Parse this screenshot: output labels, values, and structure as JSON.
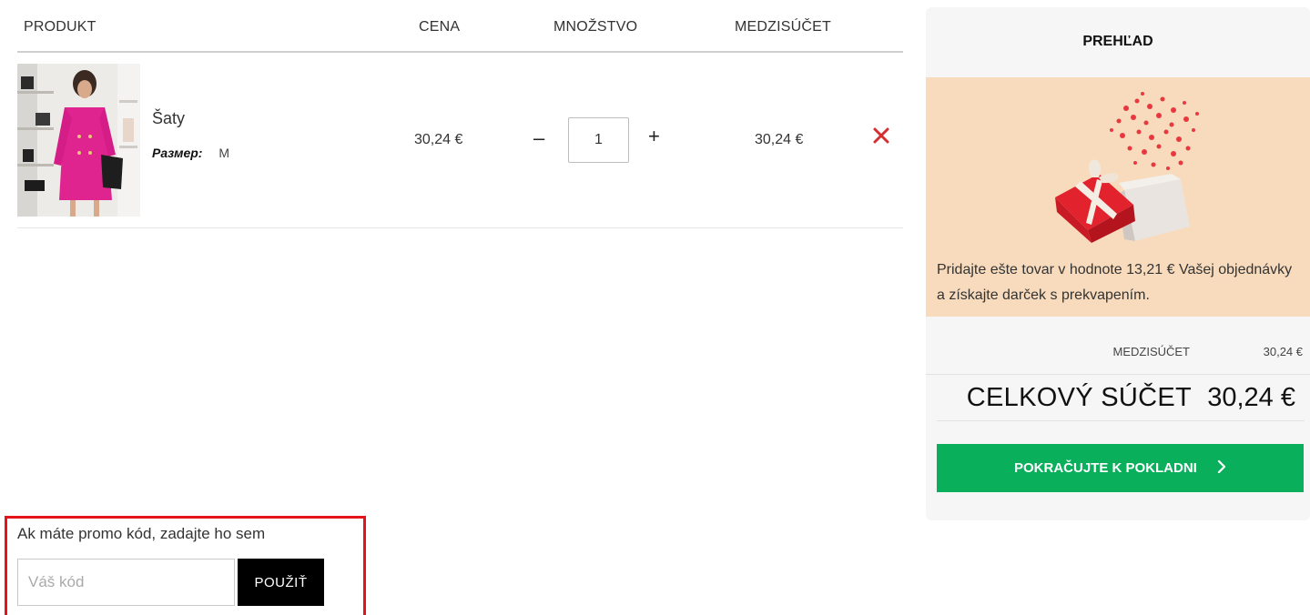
{
  "cart": {
    "headers": {
      "product": "PRODUKT",
      "price": "CENA",
      "quantity": "MNOŽSTVO",
      "subtotal": "MEDZISÚČET"
    },
    "items": [
      {
        "name": "Šaty",
        "size_label": "Размер:",
        "size_value": "M",
        "price": "30,24 €",
        "quantity": "1",
        "subtotal": "30,24 €",
        "image_icon": "product-photo-pink-dress"
      }
    ],
    "qty_minus": "–",
    "qty_plus": "+",
    "remove_icon": "close-icon"
  },
  "promo": {
    "text": "Ak máte promo kód, zadajte ho sem",
    "placeholder": "Váš kód",
    "button": "POUŽIŤ"
  },
  "summary": {
    "title": "PREHĽAD",
    "gift_text": "Pridajte ešte tovar v hodnote 13,21 € Vašej objednávky a získajte darček s prekvapením.",
    "subtotal_label": "MEDZISÚČET",
    "subtotal_value": "30,24 €",
    "total_label": "CELKOVÝ SÚČET",
    "total_value": "30,24 €",
    "checkout_button": "POKRAČUJTE K POKLADNI"
  },
  "colors": {
    "accent_green": "#0aaf5c",
    "remove_red": "#d32f2f",
    "gift_bg": "#f8dbbc",
    "highlight_border": "#e4141b"
  }
}
